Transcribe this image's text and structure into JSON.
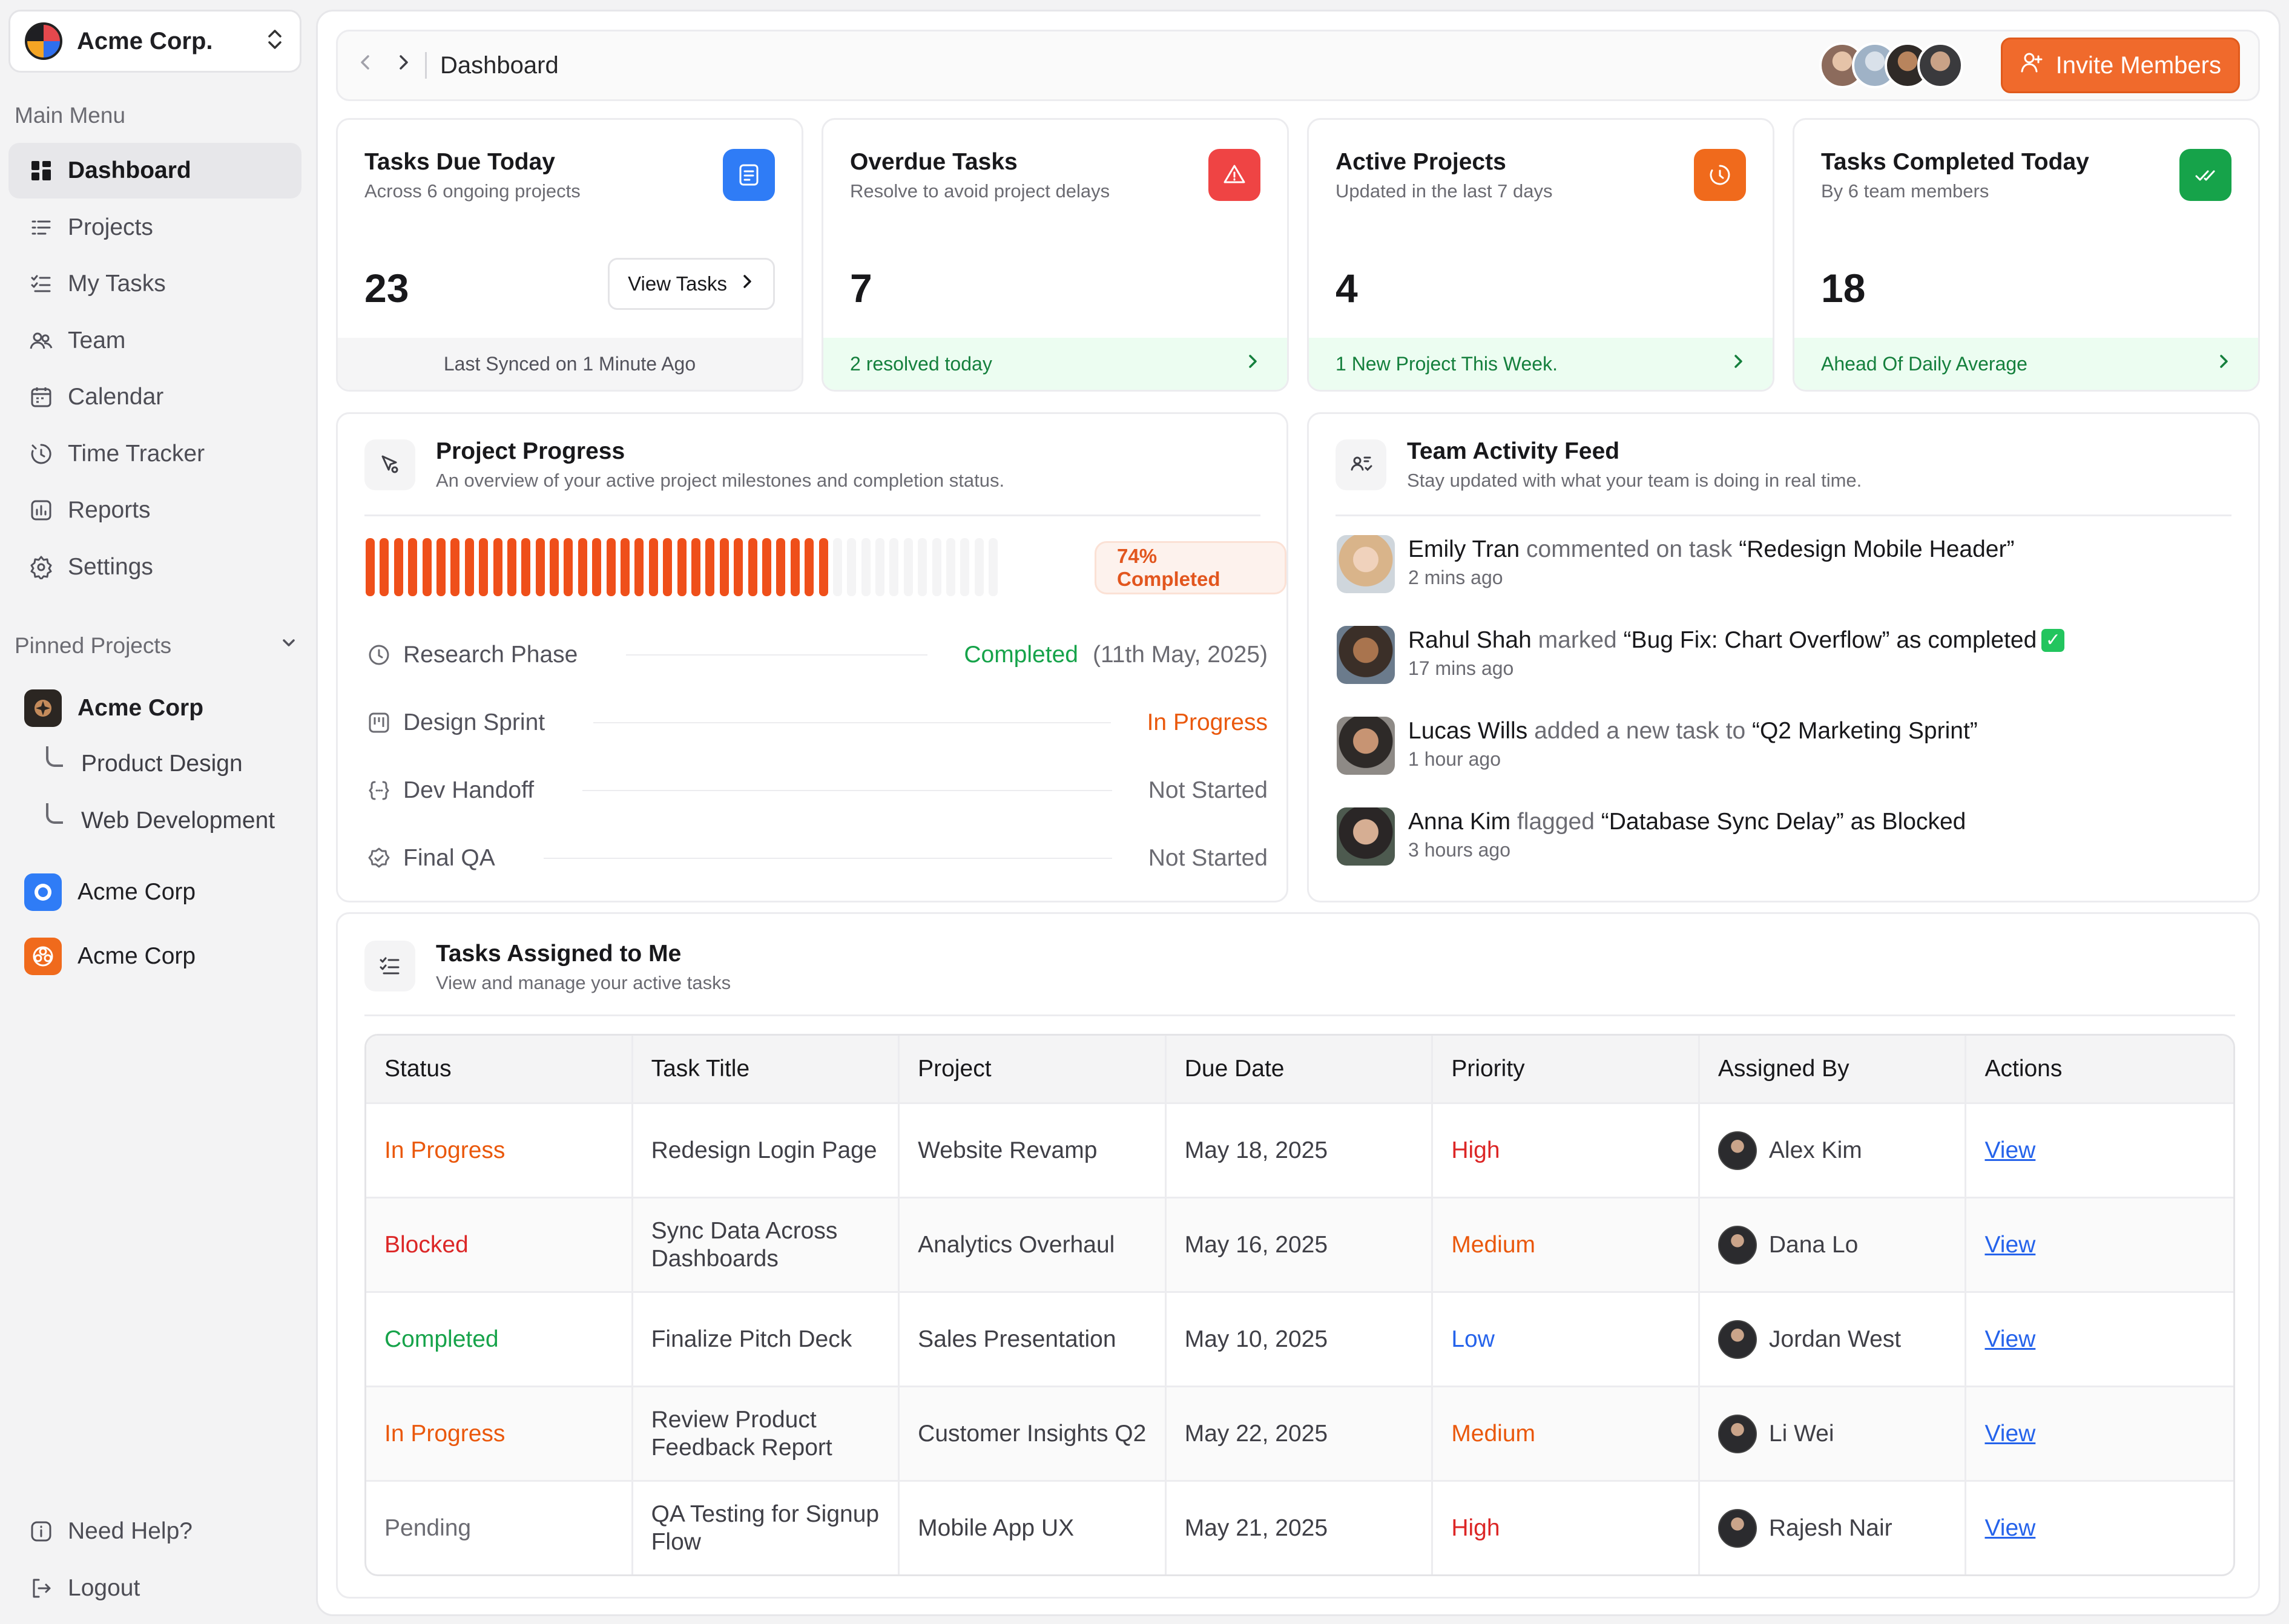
{
  "org": {
    "name": "Acme Corp."
  },
  "sidebar": {
    "main_menu_label": "Main Menu",
    "items": [
      {
        "label": "Dashboard",
        "icon": "dashboard-icon",
        "active": true
      },
      {
        "label": "Projects",
        "icon": "projects-icon"
      },
      {
        "label": "My Tasks",
        "icon": "tasks-icon"
      },
      {
        "label": "Team",
        "icon": "team-icon"
      },
      {
        "label": "Calendar",
        "icon": "calendar-icon"
      },
      {
        "label": "Time Tracker",
        "icon": "timer-icon"
      },
      {
        "label": "Reports",
        "icon": "reports-icon"
      },
      {
        "label": "Settings",
        "icon": "gear-icon"
      }
    ],
    "pinned_label": "Pinned Projects",
    "pinned": [
      {
        "label": "Acme Corp",
        "sub": [
          "Product Design",
          "Web Development"
        ]
      },
      {
        "label": "Acme Corp"
      },
      {
        "label": "Acme Corp"
      }
    ],
    "bottom": [
      {
        "label": "Need Help?",
        "icon": "help-icon"
      },
      {
        "label": "Logout",
        "icon": "logout-icon"
      }
    ]
  },
  "topbar": {
    "breadcrumb": "Dashboard",
    "invite_label": "Invite Members"
  },
  "stats": [
    {
      "title": "Tasks Due Today",
      "subtitle": "Across 6 ongoing projects",
      "value": "23",
      "button": "View Tasks",
      "footer": "Last Synced on 1 Minute Ago",
      "icon": "clipboard-icon",
      "color": "#2f7cf6"
    },
    {
      "title": "Overdue Tasks",
      "subtitle": "Resolve to avoid project delays",
      "value": "7",
      "footer": "2 resolved today",
      "icon": "alert-icon",
      "color": "#ef4444"
    },
    {
      "title": "Active Projects",
      "subtitle": "Updated in the last 7 days",
      "value": "4",
      "footer": "1 New Project This Week.",
      "icon": "timer-icon",
      "color": "#f06a1c"
    },
    {
      "title": "Tasks Completed Today",
      "subtitle": "By 6 team members",
      "value": "18",
      "footer": "Ahead Of Daily Average",
      "icon": "double-check-icon",
      "color": "#16a34a"
    }
  ],
  "progress": {
    "title": "Project Progress",
    "subtitle": "An overview of your active project milestones and completion status.",
    "percent": 74,
    "percent_label": "74% Completed",
    "phases": [
      {
        "name": "Research Phase",
        "status": "Completed",
        "date": "(11th May, 2025)",
        "tone": "green"
      },
      {
        "name": "Design Sprint",
        "status": "In Progress",
        "tone": "orange"
      },
      {
        "name": "Dev Handoff",
        "status": "Not Started",
        "tone": "grey"
      },
      {
        "name": "Final QA",
        "status": "Not Started",
        "tone": "grey"
      }
    ]
  },
  "activity": {
    "title": "Team Activity Feed",
    "subtitle": "Stay updated with what your team is doing in real time.",
    "items": [
      {
        "name": "Emily Tran",
        "verb": "commented on task",
        "object": "“Redesign Mobile Header”",
        "time": "2 mins ago"
      },
      {
        "name": "Rahul Shah",
        "verb": "marked",
        "object": "“Bug Fix: Chart Overflow” as completed",
        "time": "17 mins ago"
      },
      {
        "name": "Lucas Wills",
        "verb": "added a new task to",
        "object": "“Q2 Marketing Sprint”",
        "time": "1 hour ago"
      },
      {
        "name": "Anna Kim",
        "verb": "flagged",
        "object": "“Database Sync Delay” as Blocked",
        "time": "3 hours ago"
      }
    ]
  },
  "tasks": {
    "title": "Tasks Assigned to Me",
    "subtitle": "View and manage your active tasks",
    "columns": [
      "Status",
      "Task Title",
      "Project",
      "Due Date",
      "Priority",
      "Assigned By",
      "Actions"
    ],
    "rows": [
      {
        "status": "In Progress",
        "title": "Redesign Login Page",
        "project": "Website Revamp",
        "due": "May 18, 2025",
        "priority": "High",
        "assigned": "Alex Kim",
        "action": "View"
      },
      {
        "status": "Blocked",
        "title": "Sync Data Across Dashboards",
        "project": "Analytics Overhaul",
        "due": "May 16, 2025",
        "priority": "Medium",
        "assigned": "Dana Lo",
        "action": "View"
      },
      {
        "status": "Completed",
        "title": "Finalize Pitch Deck",
        "project": "Sales Presentation",
        "due": "May 10, 2025",
        "priority": "Low",
        "assigned": "Jordan West",
        "action": "View"
      },
      {
        "status": "In Progress",
        "title": "Review Product Feedback Report",
        "project": "Customer Insights Q2",
        "due": "May 22, 2025",
        "priority": "Medium",
        "assigned": "Li Wei",
        "action": "View"
      },
      {
        "status": "Pending",
        "title": "QA Testing for Signup Flow",
        "project": "Mobile App UX",
        "due": "May 21, 2025",
        "priority": "High",
        "assigned": "Rajesh Nair",
        "action": "View"
      }
    ]
  }
}
